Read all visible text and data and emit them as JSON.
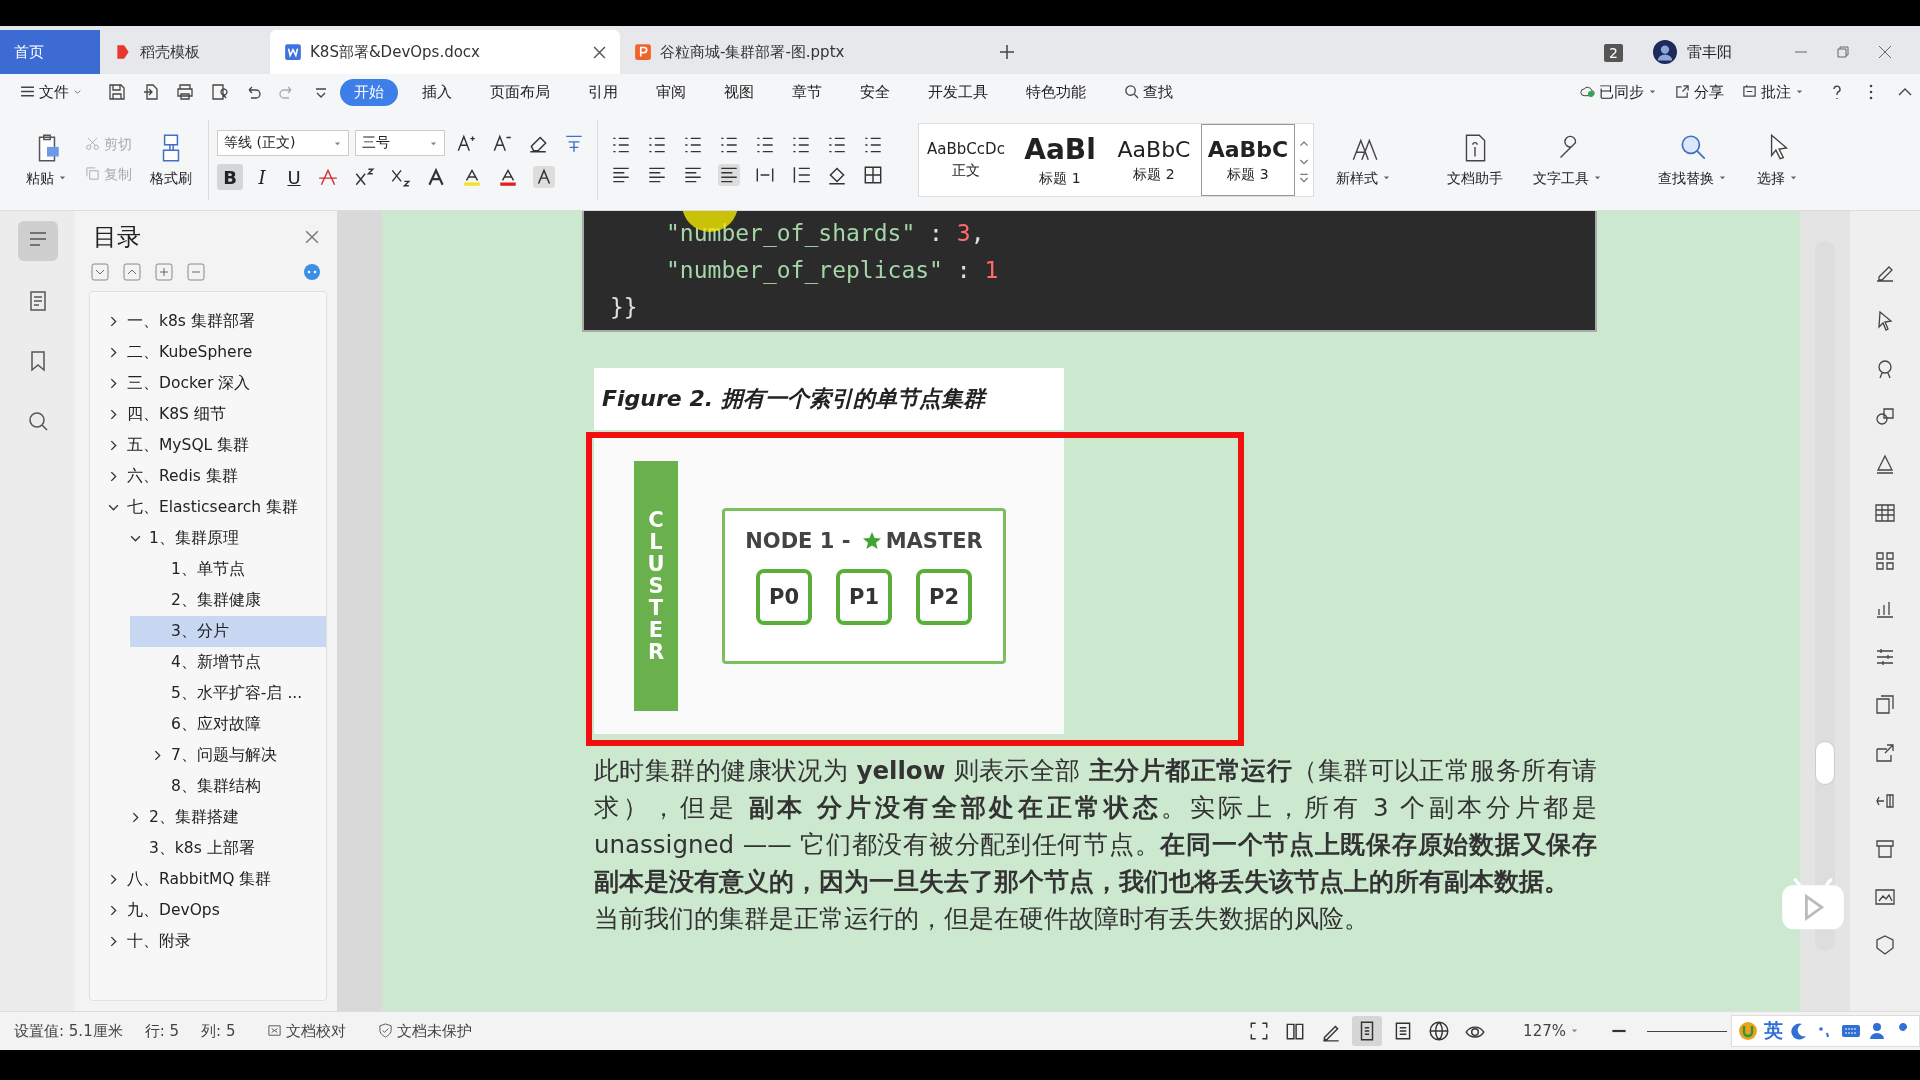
{
  "tabs": [
    {
      "label": "首页",
      "kind": "home",
      "selected": false
    },
    {
      "label": "稻壳模板",
      "kind": "docer",
      "selected": false
    },
    {
      "label": "K8S部署&DevOps.docx",
      "kind": "doc",
      "selected": true
    },
    {
      "label": "谷粒商城-集群部署-图.pptx",
      "kind": "ppt",
      "selected": false
    }
  ],
  "window": {
    "badge": "2",
    "user": "雷丰阳"
  },
  "menu": {
    "file": "文件",
    "tabs": [
      {
        "label": "开始",
        "selected": true
      },
      {
        "label": "插入",
        "selected": false
      },
      {
        "label": "页面布局",
        "selected": false
      },
      {
        "label": "引用",
        "selected": false
      },
      {
        "label": "审阅",
        "selected": false
      },
      {
        "label": "视图",
        "selected": false
      },
      {
        "label": "章节",
        "selected": false
      },
      {
        "label": "安全",
        "selected": false
      },
      {
        "label": "开发工具",
        "selected": false
      },
      {
        "label": "特色功能",
        "selected": false
      }
    ],
    "search": "查找",
    "sync": "已同步",
    "share": "分享",
    "comment": "批注"
  },
  "ribbon": {
    "paste": "粘贴",
    "cut": {
      "label": "剪切",
      "disabled": true
    },
    "copy": {
      "label": "复制",
      "disabled": true
    },
    "format_painter": "格式刷",
    "font": "等线 (正文)",
    "size": "三号",
    "format_buttons": [
      {
        "label": "B",
        "selected": true
      },
      {
        "label": "I",
        "selected": false
      },
      {
        "label": "U",
        "selected": false
      }
    ],
    "styles": [
      {
        "preview": "AaBbCcDc",
        "name": "正文",
        "selected": false
      },
      {
        "preview": "AaBl",
        "name": "标题 1",
        "selected": false
      },
      {
        "preview": "AaBbC",
        "name": "标题 2",
        "selected": false
      },
      {
        "preview": "AaBbC",
        "name": "标题 3",
        "selected": true
      }
    ],
    "tools": [
      "新样式",
      "文档助手",
      "文字工具",
      "查找替换",
      "选择"
    ]
  },
  "toc": {
    "title": "目录",
    "items": [
      {
        "label": "一、k8s 集群部署",
        "expanded": false
      },
      {
        "label": "二、KubeSphere",
        "expanded": false
      },
      {
        "label": "三、Docker 深入",
        "expanded": false
      },
      {
        "label": "四、K8S 细节",
        "expanded": false
      },
      {
        "label": "五、MySQL 集群",
        "expanded": false
      },
      {
        "label": "六、Redis 集群",
        "expanded": false
      },
      {
        "label": "七、Elasticsearch 集群",
        "expanded": true,
        "children": [
          {
            "label": "1、集群原理",
            "expanded": true,
            "children": [
              {
                "label": "1、单节点",
                "selected": false
              },
              {
                "label": "2、集群健康",
                "selected": false
              },
              {
                "label": "3、分片",
                "selected": true
              },
              {
                "label": "4、新增节点",
                "selected": false
              },
              {
                "label": "5、水平扩容-启 ...",
                "selected": false
              },
              {
                "label": "6、应对故障",
                "selected": false
              },
              {
                "label": "7、问题与解决",
                "selected": false,
                "expanded": false
              },
              {
                "label": "8、集群结构",
                "selected": false
              }
            ]
          },
          {
            "label": "2、集群搭建",
            "expanded": false
          },
          {
            "label": "3、k8s 上部署"
          }
        ]
      },
      {
        "label": "八、RabbitMQ 集群",
        "expanded": false
      },
      {
        "label": "九、DevOps",
        "expanded": false
      },
      {
        "label": "十、附录",
        "expanded": false
      }
    ]
  },
  "document": {
    "code_lines": [
      {
        "indent": true,
        "segments": [
          {
            "kind": "string",
            "text": "\"number_of_shards\""
          },
          {
            "kind": "punct",
            "text": " : "
          },
          {
            "kind": "number",
            "text": "3"
          },
          {
            "kind": "punct",
            "text": ","
          }
        ]
      },
      {
        "indent": true,
        "segments": [
          {
            "kind": "string",
            "text": "\"number_of_replicas\""
          },
          {
            "kind": "punct",
            "text": " : "
          },
          {
            "kind": "number",
            "text": "1"
          }
        ]
      },
      {
        "indent": false,
        "segments": [
          {
            "kind": "punct",
            "text": "}}"
          }
        ]
      }
    ],
    "figure_caption": "Figure 2. 拥有一个索引的单节点集群",
    "diagram": {
      "cluster": "CLUSTER",
      "node_prefix": "NODE 1 - ",
      "node_role": "MASTER",
      "shards": [
        "P0",
        "P1",
        "P2"
      ]
    },
    "paragraphs": [
      "此时集群的健康状况为 **yellow** 则表示全部 **主分片都正常运行**（集群可以正常服务所有请求），但是 **副本** **分片没有全部处在正常状态**。实际上，所有 3 个副本分片都是 unassigned —— 它们都没有被分配到任何节点。**在同一个节点上既保存原始数据又保存副本是没有意义的，因为一旦失去了那个节点，我们也将丢失该节点上的所有副本数据。**",
      "当前我们的集群是正常运行的，但是在硬件故障时有丢失数据的风险。"
    ]
  },
  "status_bar": {
    "setting": "设置值: 5.1厘米",
    "row": "行: 5",
    "col": "列: 5",
    "proofread": "文档校对",
    "protect": "文档未保护",
    "zoom": "127%",
    "ime": "英"
  }
}
